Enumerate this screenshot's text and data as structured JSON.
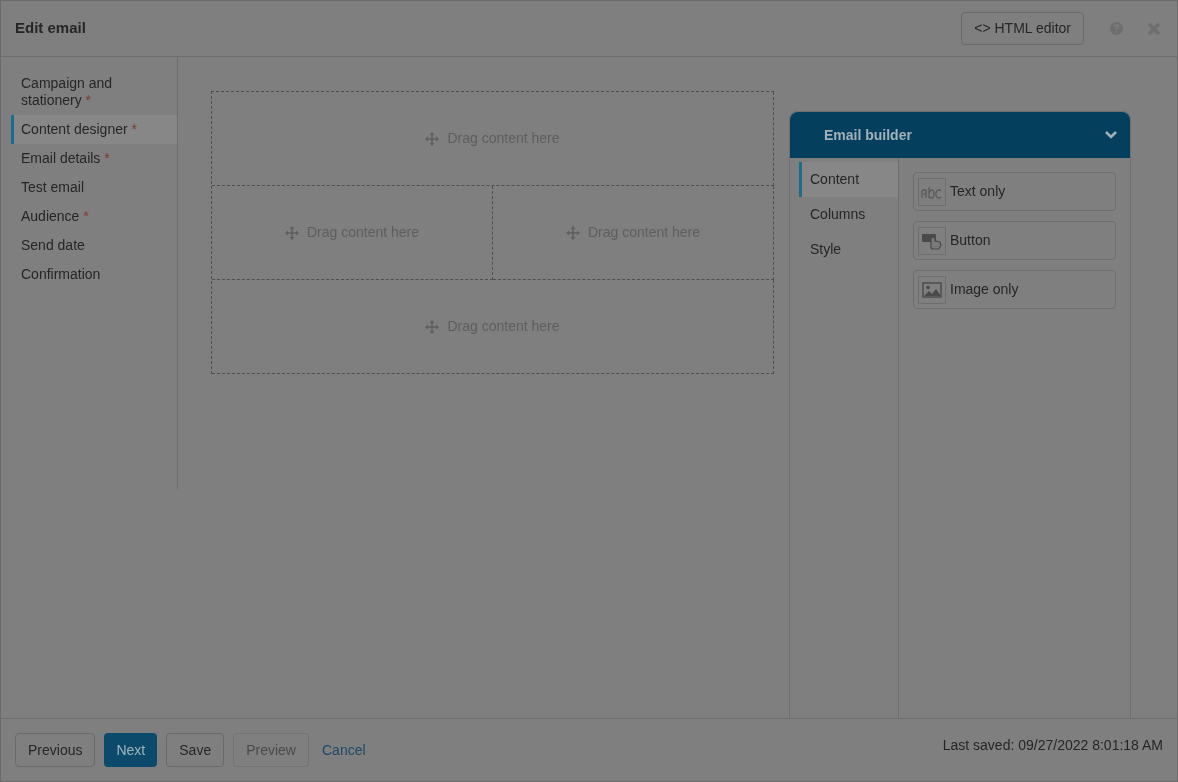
{
  "window": {
    "title": "Edit email",
    "html_editor": "<> HTML editor"
  },
  "steps": [
    {
      "label": "Campaign and stationery",
      "required_mark": "*",
      "selected": false
    },
    {
      "label": "Content designer",
      "required_mark": "*",
      "selected": true
    },
    {
      "label": "Email details",
      "required_mark": "*",
      "selected": false
    },
    {
      "label": "Test email",
      "selected": false
    },
    {
      "label": "Audience",
      "required_mark": "*",
      "selected": false
    },
    {
      "label": "Send date",
      "selected": false
    },
    {
      "label": "Confirmation",
      "selected": false
    }
  ],
  "drop_zones": [
    [
      "Drag content here"
    ],
    [
      "Drag content here",
      "Drag content here"
    ],
    [
      "Drag content here"
    ]
  ],
  "builder": {
    "title": "Email builder",
    "expanded": true,
    "tabs": [
      {
        "label": "Content",
        "selected": true
      },
      {
        "label": "Columns",
        "selected": false
      },
      {
        "label": "Style",
        "selected": false
      }
    ],
    "items": [
      {
        "kind": "text",
        "label": "Text only"
      },
      {
        "kind": "button",
        "label": "Button"
      },
      {
        "kind": "image",
        "label": "Image only"
      }
    ]
  },
  "footer": {
    "buttons": [
      {
        "kind": "default",
        "label": "Previous"
      },
      {
        "kind": "primary",
        "label": "Next"
      },
      {
        "kind": "default",
        "label": "Save"
      },
      {
        "kind": "disabled",
        "label": "Preview"
      },
      {
        "kind": "link",
        "label": "Cancel"
      }
    ],
    "last_saved": "Last saved: 09/27/2022 8:01:18 AM"
  }
}
